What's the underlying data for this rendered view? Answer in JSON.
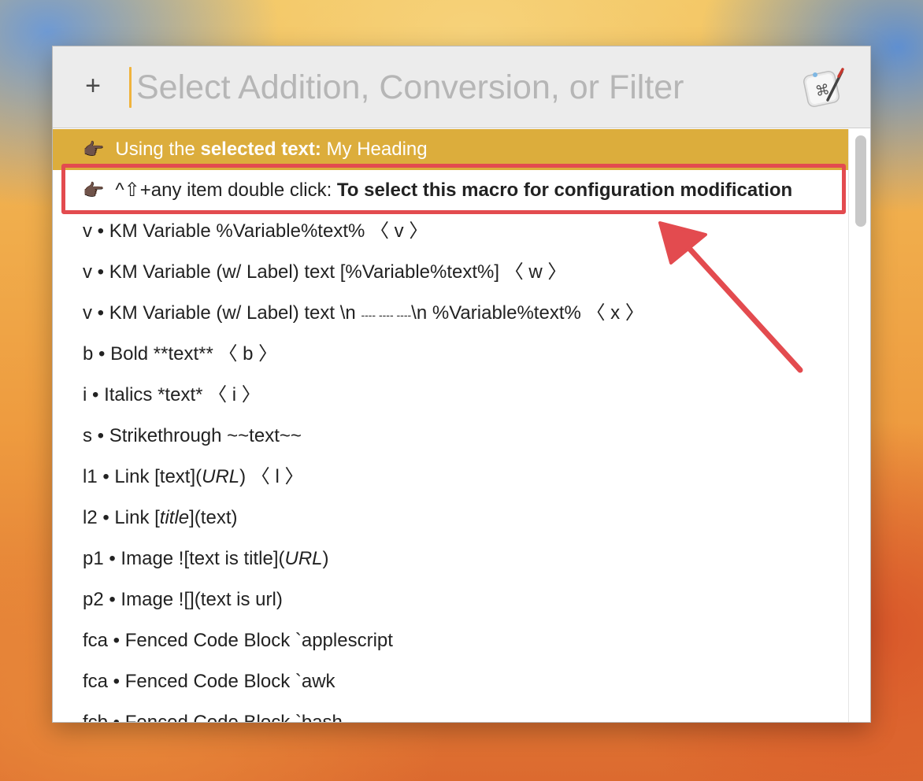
{
  "header": {
    "add_label": "+",
    "search_placeholder": "Select Addition, Conversion, or Filter",
    "app_icon": "keyboard-maestro-icon"
  },
  "selected_row": {
    "prefix": "Using the ",
    "bold": "selected text:",
    "suffix": " My Heading"
  },
  "tip_row": {
    "prefix": "^⇧+any item double click: ",
    "bold": "To select this macro for configuration modification"
  },
  "items": [
    {
      "text": "v • KM Variable %Variable%text% 〈 v 〉"
    },
    {
      "text": "v • KM Variable (w/ Label) text [%Variable%text%] 〈 w 〉"
    },
    {
      "pre": "v • KM Variable (w/ Label) text \\n ",
      "dashes": "---- ---- ----",
      "post": "\\n %Variable%text% 〈 x 〉"
    },
    {
      "text": "b • Bold **text** 〈 b 〉"
    },
    {
      "text": "i • Italics *text* 〈 i 〉"
    },
    {
      "text": "s • Strikethrough ~~text~~"
    },
    {
      "pre": "l1 • Link [text](",
      "italic": "URL",
      "post": ") 〈 l 〉"
    },
    {
      "pre": "l2 • Link [",
      "italic": "title",
      "post": "](text)"
    },
    {
      "pre": "p1 • Image ![text is title](",
      "italic": "URL",
      "post": ")"
    },
    {
      "text": "p2 • Image ![](text is url)"
    },
    {
      "text": "fca • Fenced Code Block `applescript"
    },
    {
      "text": "fca • Fenced Code Block `awk"
    },
    {
      "text": "fcb • Fenced Code Block `bash"
    }
  ],
  "colors": {
    "selected_bg": "#dcad3c",
    "highlight_border": "#e34b4f",
    "caret": "#f0b33c"
  },
  "annotation_icon": "arrow-icon",
  "hand_icon": "pointing-hand-icon"
}
